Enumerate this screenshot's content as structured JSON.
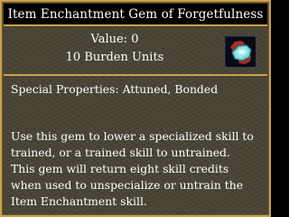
{
  "tooltip": {
    "title": "Item Enchantment Gem of Forgetfulness",
    "value_line": "Value: 0",
    "burden_line": "10 Burden Units",
    "item_icon": "gem-icon",
    "properties_line": "Special Properties: Attuned, Bonded",
    "description_lines": [
      "Use this gem to lower a specialized skill to",
      "trained, or a trained skill to untrained.",
      "This gem will return eight skill credits",
      "when used to unspecialize or untrain the",
      "Item Enchantment skill."
    ]
  },
  "colors": {
    "border_gold": "#c9a24a",
    "panel_background": "#4a4536",
    "text": "#ffffff"
  }
}
